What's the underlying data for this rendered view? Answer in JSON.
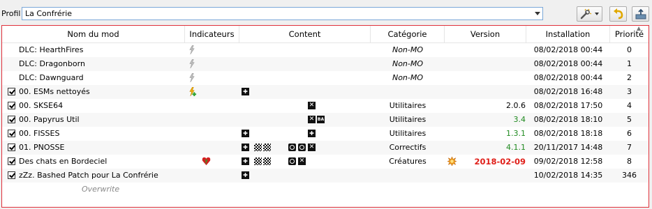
{
  "toolbar": {
    "profil_label": "Profil",
    "profil_value": "La Confrérie",
    "tools_icon": "wrench-wand-icon",
    "undo_icon": "undo-arrow-icon",
    "export_icon": "export-icon"
  },
  "columns": [
    "Nom du mod",
    "Indicateurs",
    "Content",
    "Catégorie",
    "Version",
    "Installation",
    "Priorité"
  ],
  "rows": [
    {
      "name": "DLC: HearthFires",
      "checked": false,
      "indicator": "lightning",
      "content": [],
      "category": "Non-MO",
      "category_italic": true,
      "version": "",
      "install": "08/02/2018 00:44",
      "priority": "0"
    },
    {
      "name": "DLC: Dragonborn",
      "checked": false,
      "indicator": "lightning",
      "content": [],
      "category": "Non-MO",
      "category_italic": true,
      "version": "",
      "install": "08/02/2018 00:44",
      "priority": "1"
    },
    {
      "name": "DLC: Dawnguard",
      "checked": false,
      "indicator": "lightning",
      "content": [],
      "category": "Non-MO",
      "category_italic": true,
      "version": "",
      "install": "08/02/2018 00:44",
      "priority": "2"
    },
    {
      "name": "00. ESMs nettoyés",
      "checked": true,
      "indicator": "lightning-plus",
      "content": [
        "plus@0"
      ],
      "category": "",
      "category_italic": false,
      "version": "",
      "install": "08/02/2018 16:48",
      "priority": "3"
    },
    {
      "name": "00. SKSE64",
      "checked": true,
      "indicator": "",
      "content": [
        "x@6"
      ],
      "category": "Utilitaires",
      "category_italic": false,
      "version": "2.0.6",
      "version_color": "black",
      "install": "08/02/2018 17:50",
      "priority": "4"
    },
    {
      "name": "00. Papyrus Util",
      "checked": true,
      "indicator": "",
      "content": [
        "x@6",
        "ba@7"
      ],
      "category": "Utilitaires",
      "category_italic": false,
      "version": "3.4",
      "version_color": "green",
      "install": "08/02/2018 18:10",
      "priority": "5"
    },
    {
      "name": "00. FISSES",
      "checked": true,
      "indicator": "",
      "content": [
        "plus@0",
        "plus@6"
      ],
      "category": "Utilitaires",
      "category_italic": false,
      "version": "1.3.1",
      "version_color": "green",
      "install": "08/02/2018 18:18",
      "priority": "6"
    },
    {
      "name": "01. PNOSSE",
      "checked": true,
      "indicator": "",
      "content": [
        "plus@0",
        "checker@1",
        "checker@2",
        "ring@4",
        "ring@5",
        "x@6"
      ],
      "category": "Correctifs",
      "category_italic": false,
      "version": "4.1.1",
      "version_color": "green",
      "install": "20/11/2017 14:48",
      "priority": "7"
    },
    {
      "name": "Des chats en Bordeciel",
      "checked": true,
      "indicator": "heart-question",
      "content": [
        "plus@0",
        "checker@1",
        "checker@2",
        "ring@4",
        "x@5"
      ],
      "category": "Créatures",
      "category_italic": false,
      "version": "2018-02-09",
      "version_color": "red",
      "version_flag": "update-burst-icon",
      "install": "09/02/2018 12:58",
      "priority": "8"
    },
    {
      "name": "zZz. Bashed Patch pour La Confrérie",
      "checked": true,
      "indicator": "",
      "content": [
        "plus@0"
      ],
      "category": "",
      "category_italic": false,
      "version": "",
      "install": "10/02/2018 14:35",
      "priority": "346"
    }
  ],
  "overwrite_label": "Overwrite",
  "colors": {
    "border_accent": "#e0303a",
    "version_green": "#1f8a1f",
    "version_red": "#e0201a"
  }
}
